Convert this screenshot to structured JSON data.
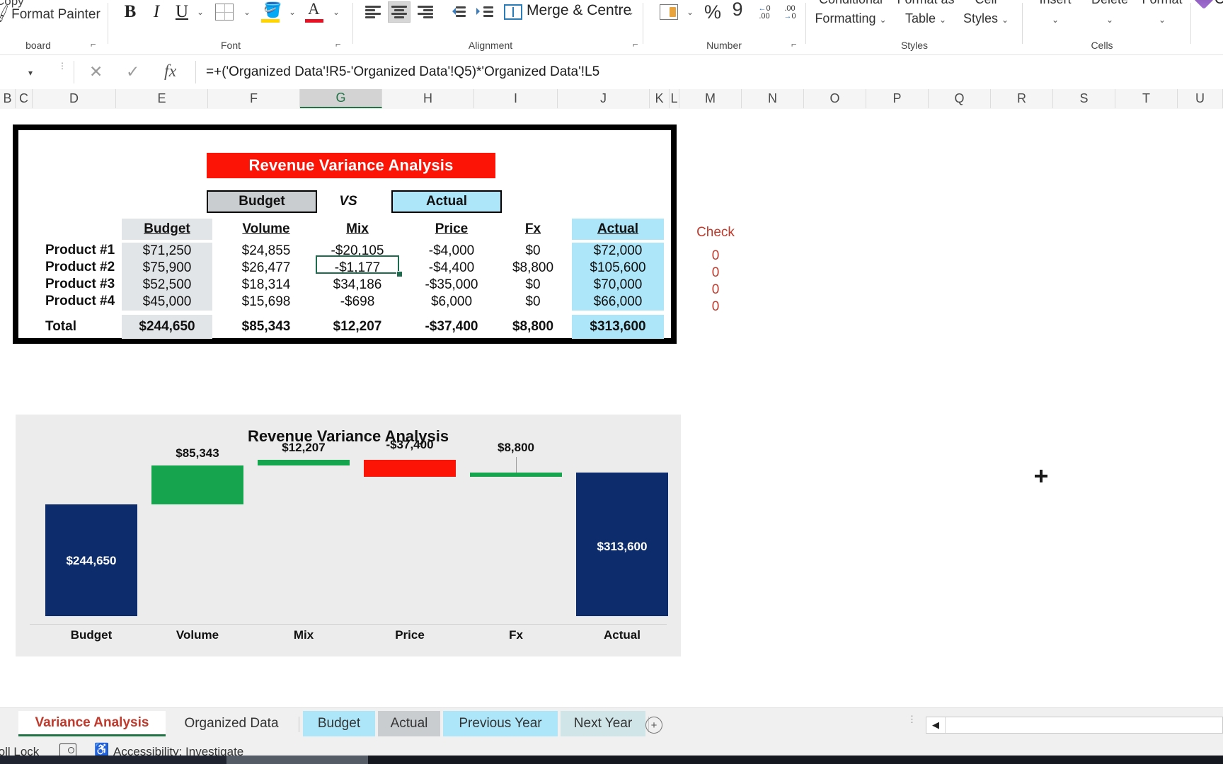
{
  "ribbon": {
    "clipboard": {
      "copy_label": "Copy",
      "format_painter_label": "Format Painter",
      "group_label": "board",
      "launcher": "⌐"
    },
    "font": {
      "bold": "B",
      "italic": "I",
      "underline": "U",
      "group_label": "Font",
      "launcher": "⌐"
    },
    "alignment": {
      "merge_label": "Merge & Centre",
      "group_label": "Alignment",
      "launcher": "⌐"
    },
    "number": {
      "percent": "%",
      "comma": "9",
      "dec_inc": ".00",
      "dec_dec": ".00",
      "group_label": "Number",
      "launcher": "⌐"
    },
    "styles": {
      "conditional_formatting": "Conditional Formatting",
      "format_as_table": "Format as Table",
      "cell_styles": "Cell Styles",
      "group_label": "Styles"
    },
    "cells": {
      "insert": "Insert",
      "delete": "Delete",
      "format": "Format",
      "group_label": "Cells"
    },
    "editing": {
      "clear": "Clear"
    }
  },
  "formula_bar": {
    "cancel_icon": "✕",
    "enter_icon": "✓",
    "fx_icon": "fx",
    "formula": "=+('Organized Data'!R5-'Organized Data'!Q5)*'Organized Data'!L5"
  },
  "columns": [
    "B",
    "C",
    "D",
    "E",
    "F",
    "G",
    "H",
    "I",
    "J",
    "K",
    "L",
    "M",
    "N",
    "O",
    "P",
    "Q",
    "R",
    "S",
    "T",
    "U"
  ],
  "selected_column": "G",
  "worksheet": {
    "banner_title": "Revenue Variance Analysis",
    "compare": {
      "left": "Budget",
      "middle": "VS",
      "right": "Actual"
    },
    "table": {
      "headers": [
        "Budget",
        "Volume",
        "Mix",
        "Price",
        "Fx",
        "Actual"
      ],
      "rows": [
        {
          "label": "Product #1",
          "values": [
            "$71,250",
            "$24,855",
            "-$20,105",
            "-$4,000",
            "$0",
            "$72,000"
          ]
        },
        {
          "label": "Product #2",
          "values": [
            "$75,900",
            "$26,477",
            "-$1,177",
            "-$4,400",
            "$8,800",
            "$105,600"
          ]
        },
        {
          "label": "Product #3",
          "values": [
            "$52,500",
            "$18,314",
            "$34,186",
            "-$35,000",
            "$0",
            "$70,000"
          ]
        },
        {
          "label": "Product #4",
          "values": [
            "$45,000",
            "$15,698",
            "-$698",
            "$6,000",
            "$0",
            "$66,000"
          ]
        }
      ],
      "total": {
        "label": "Total",
        "values": [
          "$244,650",
          "$85,343",
          "$12,207",
          "-$37,400",
          "$8,800",
          "$313,600"
        ]
      }
    },
    "check": {
      "header": "Check",
      "values": [
        "0",
        "0",
        "0",
        "0"
      ]
    },
    "selected_cell_value": "-$1,177"
  },
  "chart_data": {
    "type": "bar",
    "title": "Revenue Variance Analysis",
    "categories": [
      "Budget",
      "Volume",
      "Mix",
      "Price",
      "Fx",
      "Actual"
    ],
    "values": [
      244650,
      85343,
      12207,
      -37400,
      8800,
      313600
    ],
    "labels": [
      "$244,650",
      "$85,343",
      "$12,207",
      "-$37,400",
      "$8,800",
      "$313,600"
    ],
    "kinds": [
      "total",
      "increase",
      "increase",
      "decrease",
      "increase",
      "total"
    ],
    "bases": [
      0,
      244650,
      329993,
      342200,
      304800,
      0
    ],
    "colors": {
      "total": "#0d2c6b",
      "increase": "#17a44f",
      "decrease": "#fc1407",
      "plot_bg": "#ececec"
    },
    "xlabel": "",
    "ylabel": "",
    "ylim": [
      0,
      345000
    ],
    "grid": false,
    "legend": "none"
  },
  "sheet_tabs": [
    {
      "name": "Variance Analysis",
      "active": true,
      "color": ""
    },
    {
      "name": "Organized Data",
      "active": false,
      "color": ""
    },
    {
      "name": "Budget",
      "active": false,
      "color": "#ace6f8"
    },
    {
      "name": "Actual",
      "active": false,
      "color": "#c9cdd0"
    },
    {
      "name": "Previous Year",
      "active": false,
      "color": "#ace6f8"
    },
    {
      "name": "Next Year",
      "active": false,
      "color": "#cfe5e8"
    }
  ],
  "add_sheet_label": "+",
  "status_bar": {
    "scroll_lock": "roll Lock",
    "accessibility": "Accessibility: Investigate"
  }
}
